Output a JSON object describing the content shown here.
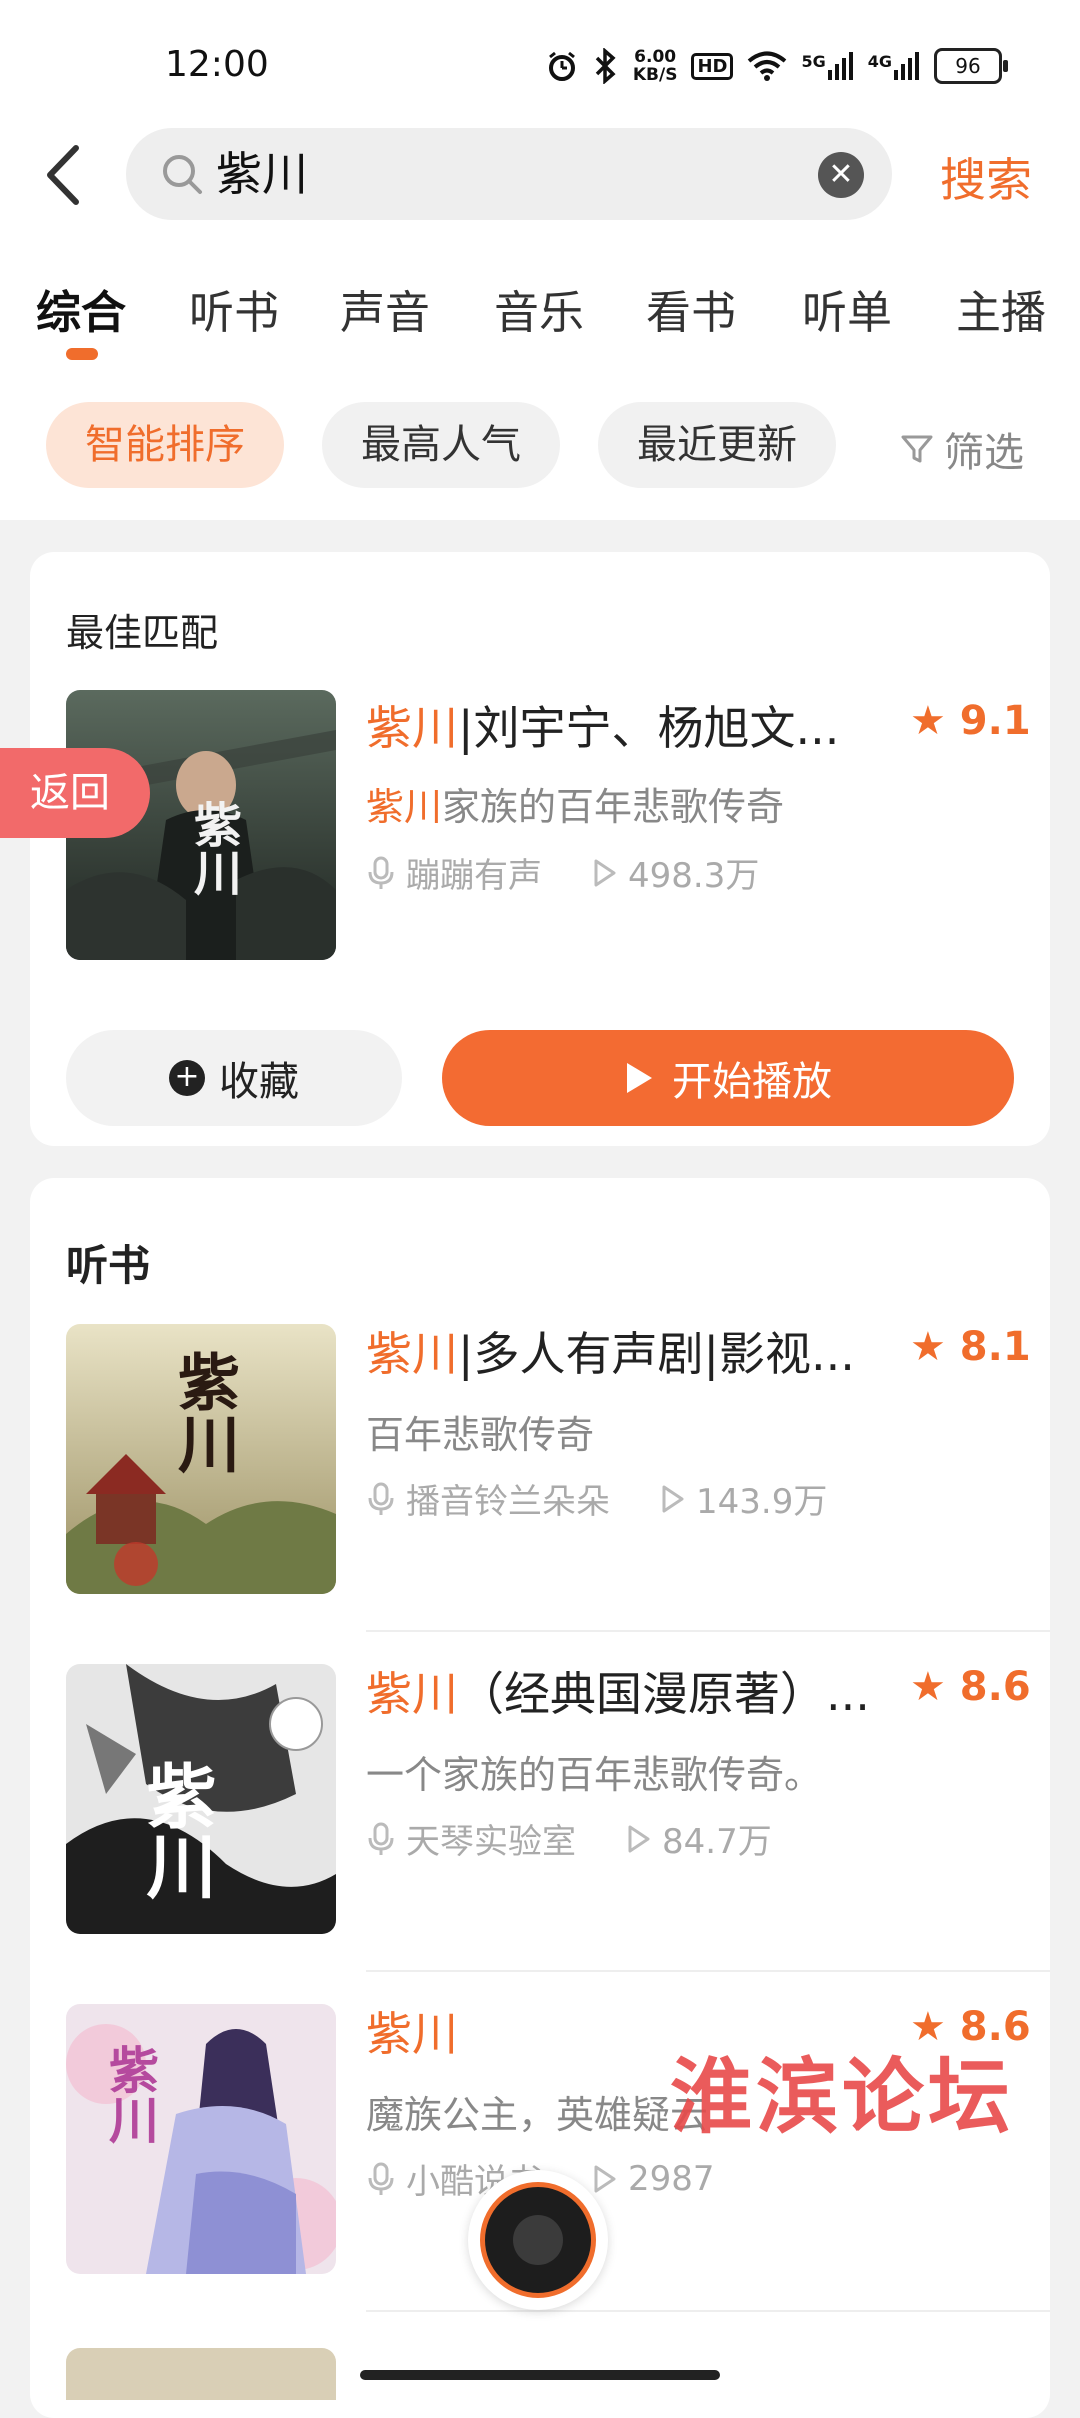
{
  "status_bar": {
    "time": "12:00",
    "net_speed_value": "6.00",
    "net_speed_unit": "KB/S",
    "hd_label": "HD",
    "signal1": "5G",
    "signal2": "4G",
    "battery": "96"
  },
  "search": {
    "query": "紫川",
    "button_label": "搜索"
  },
  "tabs": [
    "综合",
    "听书",
    "声音",
    "音乐",
    "看书",
    "听单",
    "主播"
  ],
  "filters": {
    "chips": [
      "智能排序",
      "最高人气",
      "最近更新"
    ],
    "filter_label": "筛选"
  },
  "best_match": {
    "section_title": "最佳匹配",
    "title_highlight": "紫川",
    "title_rest": "|刘宇宁、杨旭文...",
    "rating": "9.1",
    "desc_highlight": "紫川",
    "desc_rest": "家族的百年悲歌传奇",
    "author": "蹦蹦有声",
    "plays": "498.3万",
    "collect_label": "收藏",
    "play_label": "开始播放",
    "cover_text": "紫川"
  },
  "audiobooks": {
    "section_title": "听书",
    "items": [
      {
        "title_highlight": "紫川",
        "title_rest": "|多人有声剧|影视...",
        "rating": "8.1",
        "desc": "百年悲歌传奇",
        "author": "播音铃兰朵朵",
        "plays": "143.9万",
        "cover_text": "紫川"
      },
      {
        "title_highlight": "紫川",
        "title_rest": "（经典国漫原著）...",
        "rating": "8.6",
        "desc": "一个家族的百年悲歌传奇。",
        "author": "天琴实验室",
        "plays": "84.7万",
        "cover_text": "紫川"
      },
      {
        "title_highlight": "紫川",
        "title_rest": "",
        "rating": "8.6",
        "desc": "魔族公主，英雄疑云",
        "author": "小酷说书",
        "plays": "2987",
        "cover_text": "紫川"
      }
    ]
  },
  "floating": {
    "return_label": "返回",
    "watermark": "淮滨论坛"
  },
  "colors": {
    "accent": "#f06d2c",
    "play_button": "#f36b32",
    "return_tag": "#f26a6a"
  }
}
